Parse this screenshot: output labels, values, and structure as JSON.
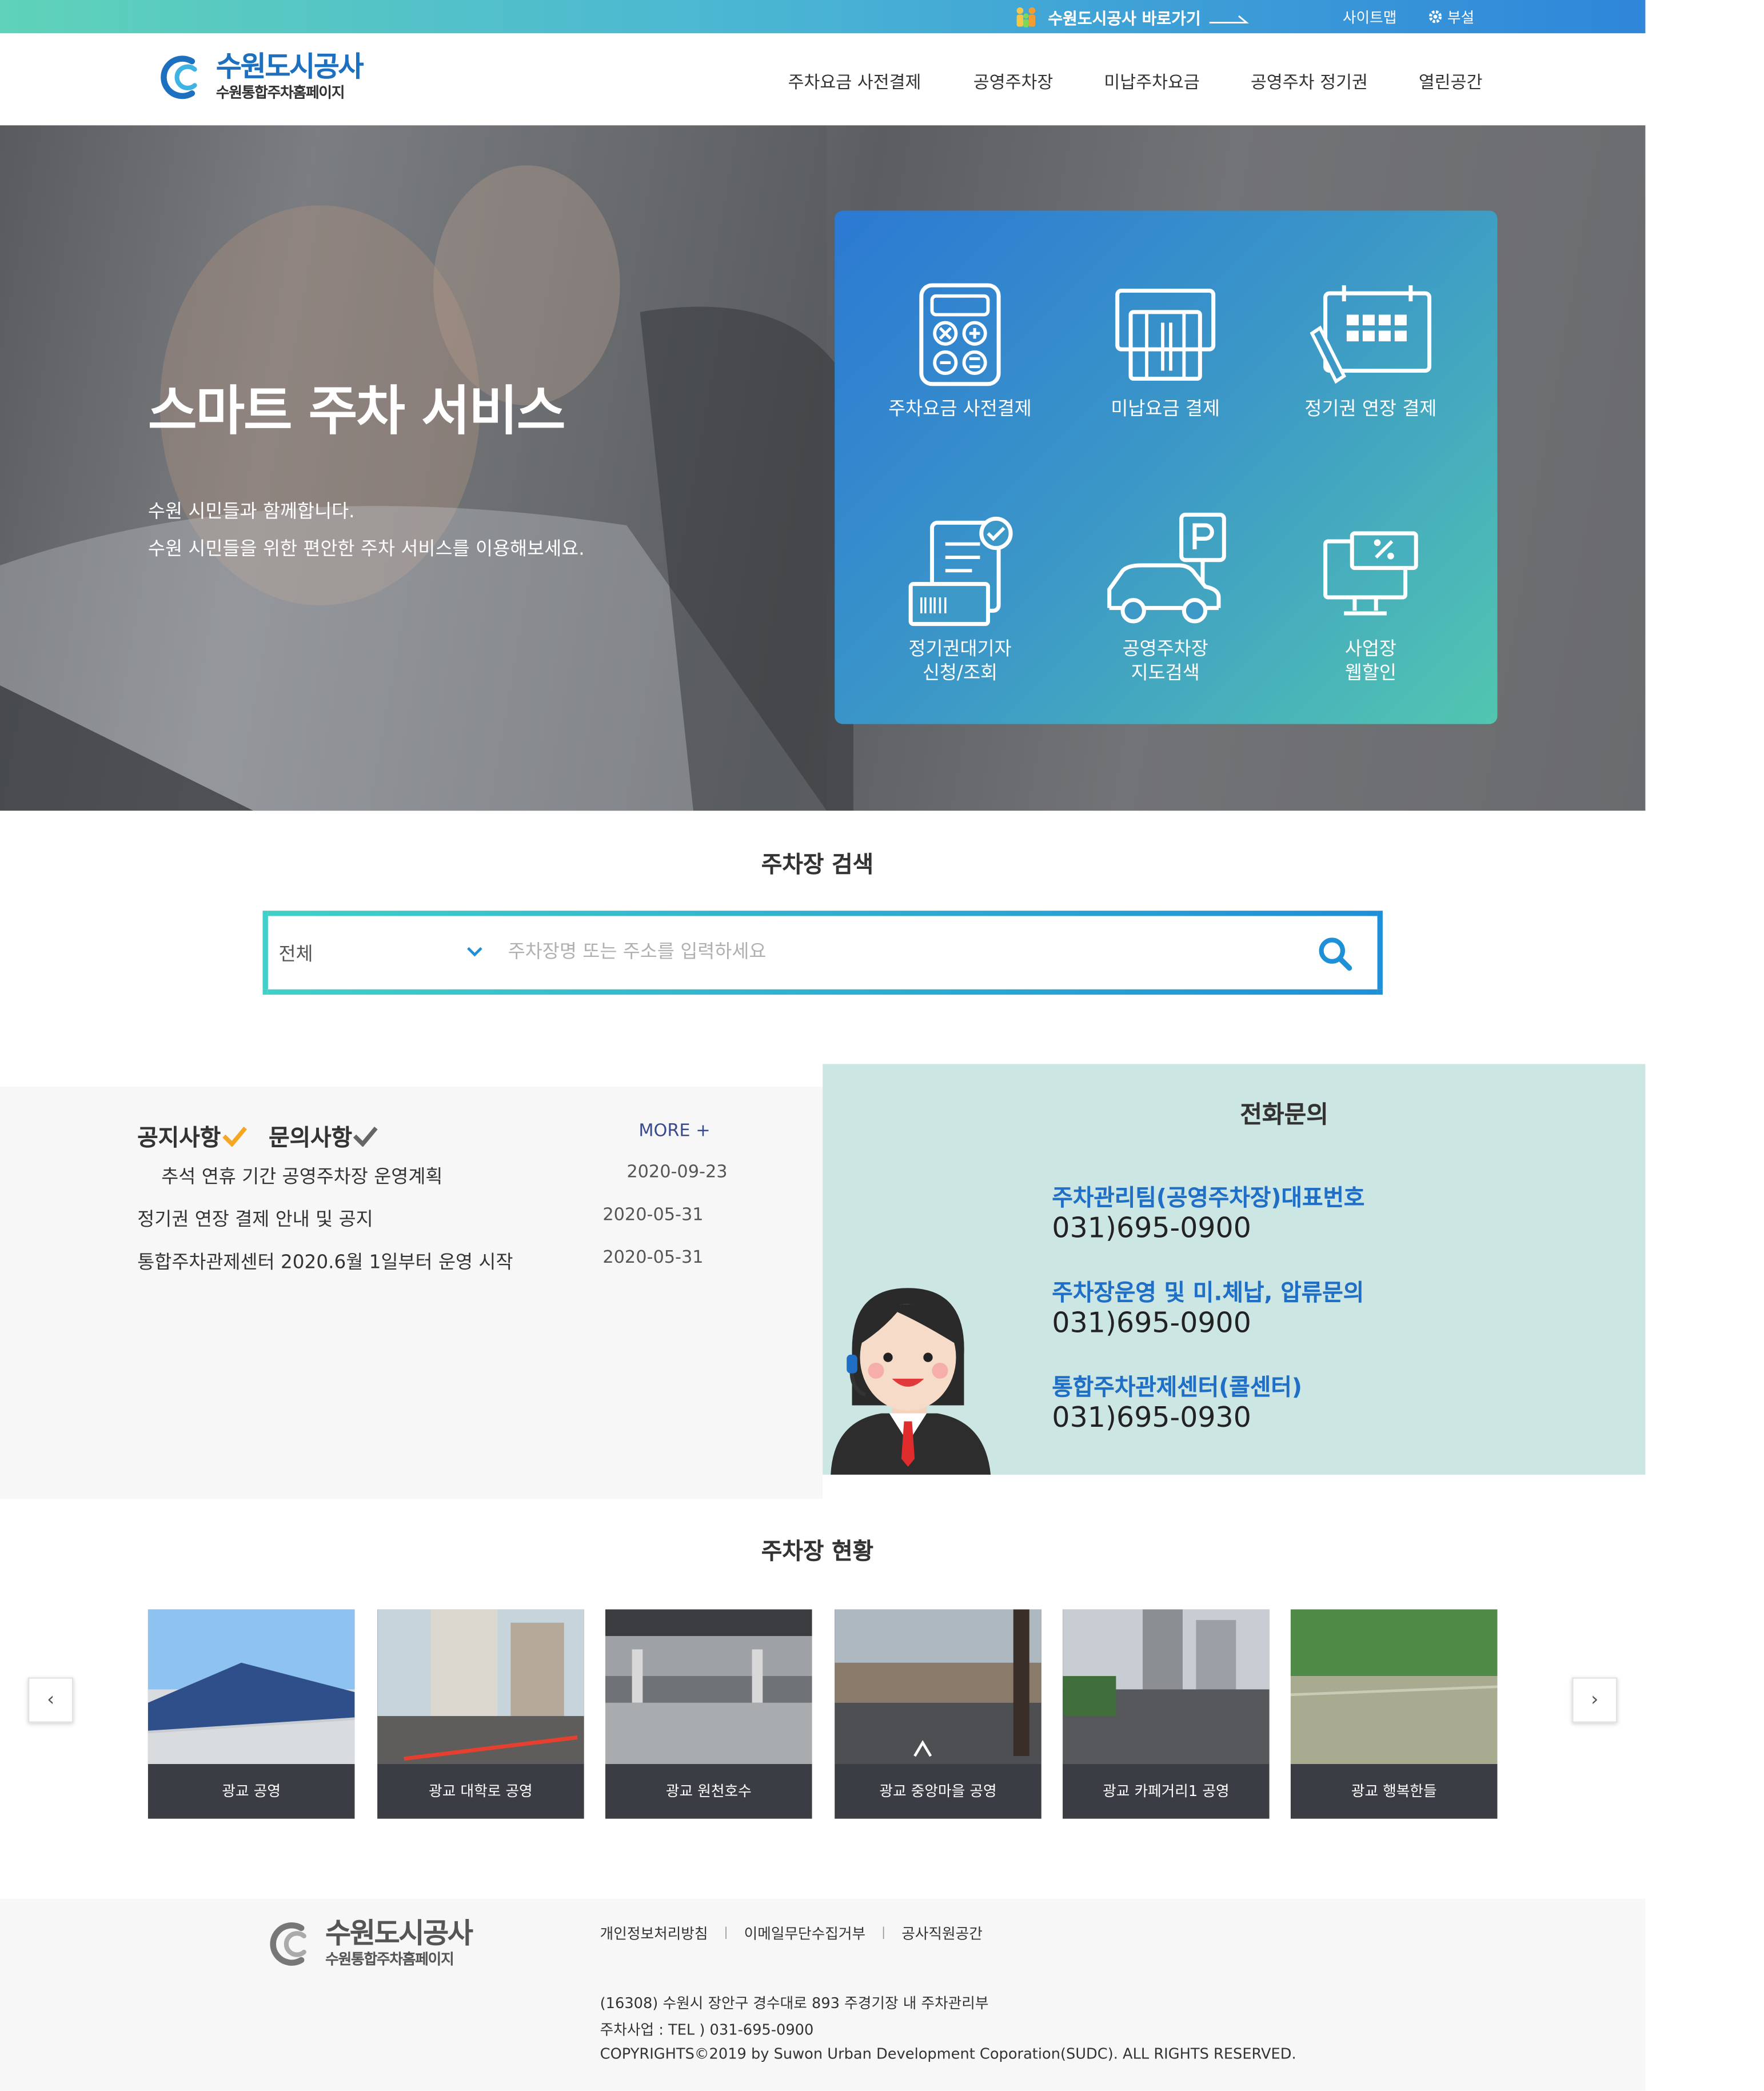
{
  "topbar": {
    "shortcut_label": "수원도시공사 바로가기",
    "sitemap": "사이트맵",
    "dept": "부설"
  },
  "header": {
    "logo_title": "수원도시공사",
    "logo_subtitle": "수원통합주차홈페이지",
    "nav": [
      "주차요금 사전결제",
      "공영주차장",
      "미납주차요금",
      "공영주차 정기권",
      "열린공간"
    ]
  },
  "hero": {
    "title": "스마트 주차 서비스",
    "sub1": "수원 시민들과 함께합니다.",
    "sub2": "수원 시민들을 위한 편안한 주차 서비스를 이용해보세요.",
    "services": [
      {
        "label": "주차요금 사전결제",
        "icon": "calculator-icon"
      },
      {
        "label": "미납요금 결제",
        "icon": "card-payment-icon"
      },
      {
        "label": "정기권 연장 결제",
        "icon": "calendar-pencil-icon"
      },
      {
        "label": "정기권대기자\n신청/조회",
        "icon": "ticket-check-icon"
      },
      {
        "label": "공영주차장\n지도검색",
        "icon": "car-parking-icon"
      },
      {
        "label": "사업장\n웹할인",
        "icon": "monitor-discount-icon"
      }
    ]
  },
  "search": {
    "title": "주차장 검색",
    "category": "전체",
    "placeholder": "주차장명 또는 주소를 입력하세요"
  },
  "notice": {
    "tab1": "공지사항",
    "tab2": "문의사항",
    "more": "MORE +",
    "items": [
      {
        "title": "추석 연휴 기간 공영주차장 운영계획",
        "date": "2020-09-23"
      },
      {
        "title": "정기권 연장 결제 안내 및 공지",
        "date": "2020-05-31"
      },
      {
        "title": "통합주차관제센터 2020.6월 1일부터 운영 시작",
        "date": "2020-05-31"
      }
    ]
  },
  "call": {
    "title": "전화문의",
    "entries": [
      {
        "name": "주차관리팀(공영주차장)대표번호",
        "phone": "031)695-0900"
      },
      {
        "name": "주차장운영 및 미.체납, 압류문의",
        "phone": "031)695-0900"
      },
      {
        "name": "통합주차관제센터(콜센터)",
        "phone": "031)695-0930"
      }
    ]
  },
  "lots": {
    "title": "주차장 현황",
    "items": [
      "광교 공영",
      "광교 대학로 공영",
      "광교 원천호수",
      "광교 중앙마을 공영",
      "광교 카페거리1 공영",
      "광교 행복한들"
    ],
    "prev": "‹",
    "next": "›"
  },
  "footer": {
    "logo_title": "수원도시공사",
    "logo_subtitle": "수원통합주차홈페이지",
    "links": [
      "개인정보처리방침",
      "이메일무단수집거부",
      "공사직원공간"
    ],
    "address": "(16308) 수원시 장안구 경수대로 893 주경기장 내 주차관리부",
    "tel": "주차사업 : TEL ) 031-695-0900",
    "copyright": "COPYRIGHTS©2019 by Suwon Urban Development Coporation(SUDC). ALL RIGHTS RESERVED."
  },
  "colors": {
    "brand_blue": "#1d6fc0",
    "accent_teal": "#21a6d6",
    "call_panel": "#cce6e3",
    "lot_caption": "#3b3d44",
    "notice_check": "#f5a623"
  }
}
